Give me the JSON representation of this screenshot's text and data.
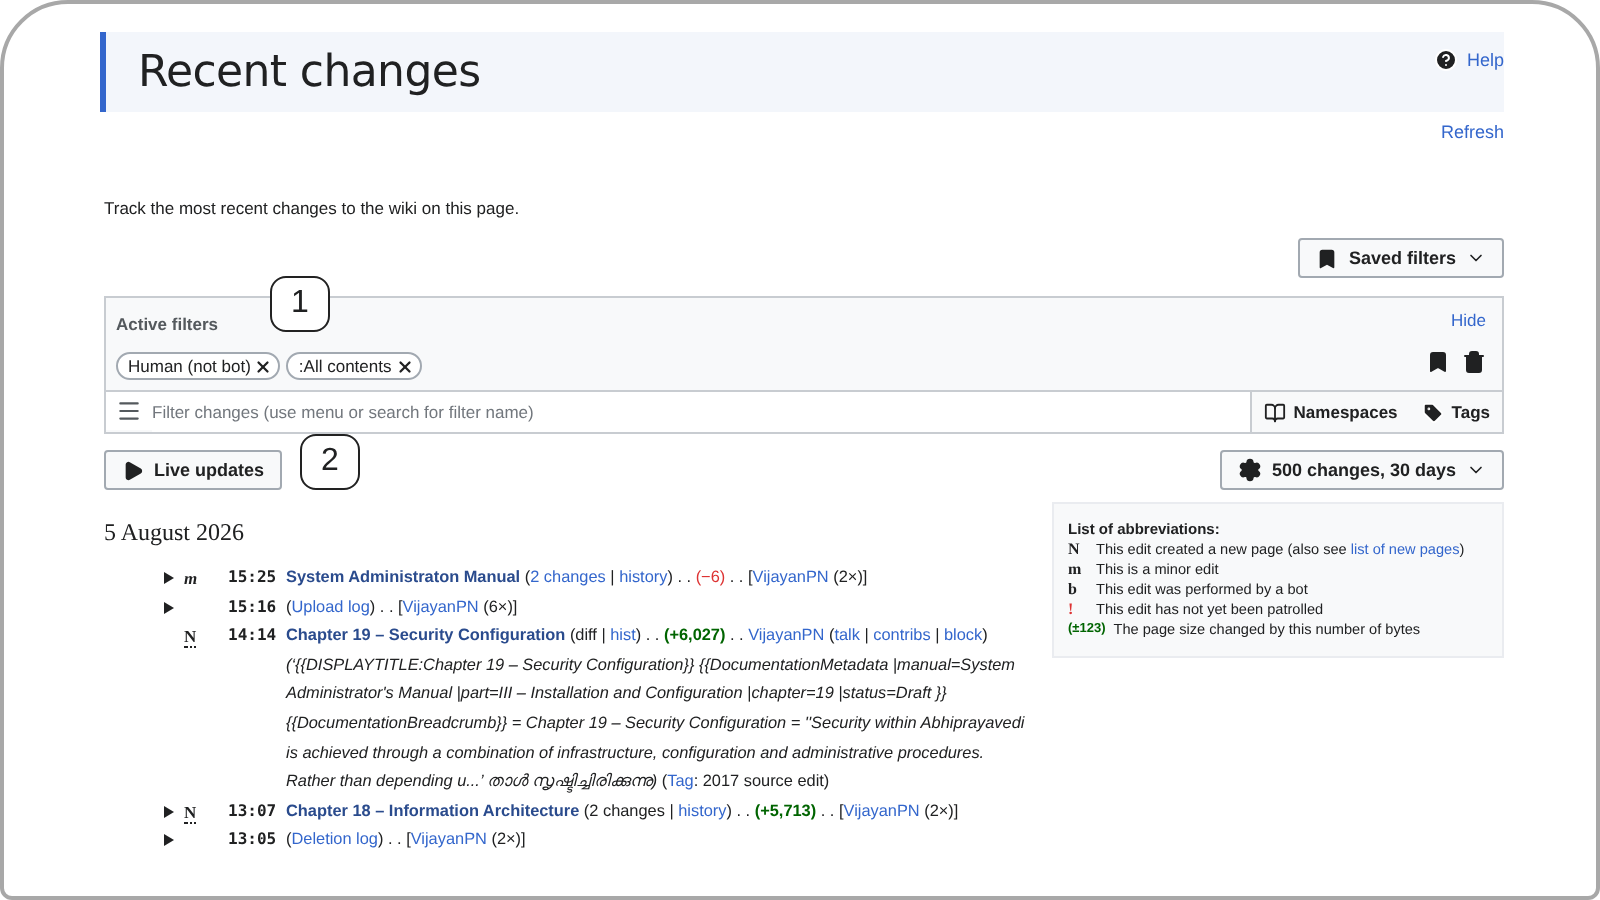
{
  "header": {
    "title": "Recent changes",
    "help": "Help"
  },
  "refresh": "Refresh",
  "description": "Track the most recent changes to the wiki on this page.",
  "saved_filters": "Saved filters",
  "active_filters": {
    "label": "Active filters",
    "hide": "Hide",
    "chips": [
      "Human (not bot)",
      ":All contents"
    ]
  },
  "filter_field": {
    "placeholder": "Filter changes (use menu or search for filter name)"
  },
  "filter_buttons": [
    {
      "label": "Namespaces",
      "kind": "namespaces"
    },
    {
      "label": "Tags",
      "kind": "tags"
    }
  ],
  "live_updates": "Live updates",
  "limit_button": "500 changes, 30 days",
  "callouts": [
    "1",
    "2"
  ],
  "date": "5 August 2026",
  "rows": [
    {
      "expandable": true,
      "flag": "m",
      "time": "15:25",
      "segments": [
        {
          "kind": "title",
          "text": "System Administraton Manual"
        },
        {
          "kind": "plain",
          "text": " ("
        },
        {
          "kind": "link",
          "text": "2 changes"
        },
        {
          "kind": "plain",
          "text": " | "
        },
        {
          "kind": "link",
          "text": "history"
        },
        {
          "kind": "plain",
          "text": ") . . "
        },
        {
          "kind": "neg",
          "text": "(−6)"
        },
        {
          "kind": "plain",
          "text": " . . ["
        },
        {
          "kind": "link",
          "text": "VijayanPN"
        },
        {
          "kind": "plain",
          "text": " (2×)]"
        }
      ]
    },
    {
      "expandable": true,
      "flag": "",
      "time": "15:16",
      "segments": [
        {
          "kind": "plain",
          "text": "("
        },
        {
          "kind": "link",
          "text": "Upload log"
        },
        {
          "kind": "plain",
          "text": ") . . ["
        },
        {
          "kind": "link",
          "text": "VijayanPN"
        },
        {
          "kind": "plain",
          "text": " (6×)]"
        }
      ]
    },
    {
      "expandable": false,
      "flag": "N",
      "time": "14:14",
      "segments": [
        {
          "kind": "title",
          "text": "Chapter 19 – Security Configuration"
        },
        {
          "kind": "plain",
          "text": " (diff | "
        },
        {
          "kind": "link",
          "text": "hist"
        },
        {
          "kind": "plain",
          "text": ") . . "
        },
        {
          "kind": "pos",
          "text": "(+6,027)"
        },
        {
          "kind": "plain",
          "text": " . . "
        },
        {
          "kind": "link",
          "text": "VijayanPN"
        },
        {
          "kind": "plain",
          "text": " ("
        },
        {
          "kind": "link",
          "text": "talk"
        },
        {
          "kind": "plain",
          "text": " | "
        },
        {
          "kind": "link",
          "text": "contribs"
        },
        {
          "kind": "plain",
          "text": " | "
        },
        {
          "kind": "link",
          "text": "block"
        },
        {
          "kind": "plain",
          "text": ") "
        },
        {
          "kind": "italic",
          "text": "(‘{{DISPLAYTITLE:Chapter 19 – Security Configuration}} {{DocumentationMetadata |manual=System Administrator's Manual |part=III – Installation and Configuration |chapter=19 |status=Draft }} {{DocumentationBreadcrumb}} = Chapter 19 – Security Configuration = ''Security within Abhiprayavedi is achieved through a combination of infrastructure, configuration and administrative procedures. Rather than depending u...’ താൾ സൃഷ്ടിച്ചിരിക്കുന്നു)"
        },
        {
          "kind": "plain",
          "text": " ("
        },
        {
          "kind": "link",
          "text": "Tag"
        },
        {
          "kind": "plain",
          "text": ": 2017 source edit)"
        }
      ]
    },
    {
      "expandable": true,
      "flag": "N",
      "time": "13:07",
      "segments": [
        {
          "kind": "title",
          "text": "Chapter 18 – Information Architecture"
        },
        {
          "kind": "plain",
          "text": " (2 changes | "
        },
        {
          "kind": "link",
          "text": "history"
        },
        {
          "kind": "plain",
          "text": ") . . "
        },
        {
          "kind": "pos",
          "text": "(+5,713)"
        },
        {
          "kind": "plain",
          "text": " . . ["
        },
        {
          "kind": "link",
          "text": "VijayanPN"
        },
        {
          "kind": "plain",
          "text": " (2×)]"
        }
      ]
    },
    {
      "expandable": true,
      "flag": "",
      "time": "13:05",
      "segments": [
        {
          "kind": "plain",
          "text": "("
        },
        {
          "kind": "link",
          "text": "Deletion log"
        },
        {
          "kind": "plain",
          "text": ") . . ["
        },
        {
          "kind": "link",
          "text": "VijayanPN"
        },
        {
          "kind": "plain",
          "text": " (2×)]"
        }
      ]
    }
  ],
  "legend": {
    "title": "List of abbreviations:",
    "items": [
      {
        "key": "N",
        "kind": "new",
        "segments": [
          {
            "kind": "plain",
            "text": "This edit created a new page (also see "
          },
          {
            "kind": "link",
            "text": "list of new pages"
          },
          {
            "kind": "plain",
            "text": ")"
          }
        ]
      },
      {
        "key": "m",
        "kind": "minor",
        "segments": [
          {
            "kind": "plain",
            "text": "This is a minor edit"
          }
        ]
      },
      {
        "key": "b",
        "kind": "bot",
        "segments": [
          {
            "kind": "plain",
            "text": "This edit was performed by a bot"
          }
        ]
      },
      {
        "key": "!",
        "kind": "unpatrolled",
        "segments": [
          {
            "kind": "plain",
            "text": "This edit has not yet been patrolled"
          }
        ]
      },
      {
        "key": "(±123)",
        "kind": "size",
        "segments": [
          {
            "kind": "plain",
            "text": "The page size changed by this number of bytes"
          }
        ]
      }
    ]
  }
}
